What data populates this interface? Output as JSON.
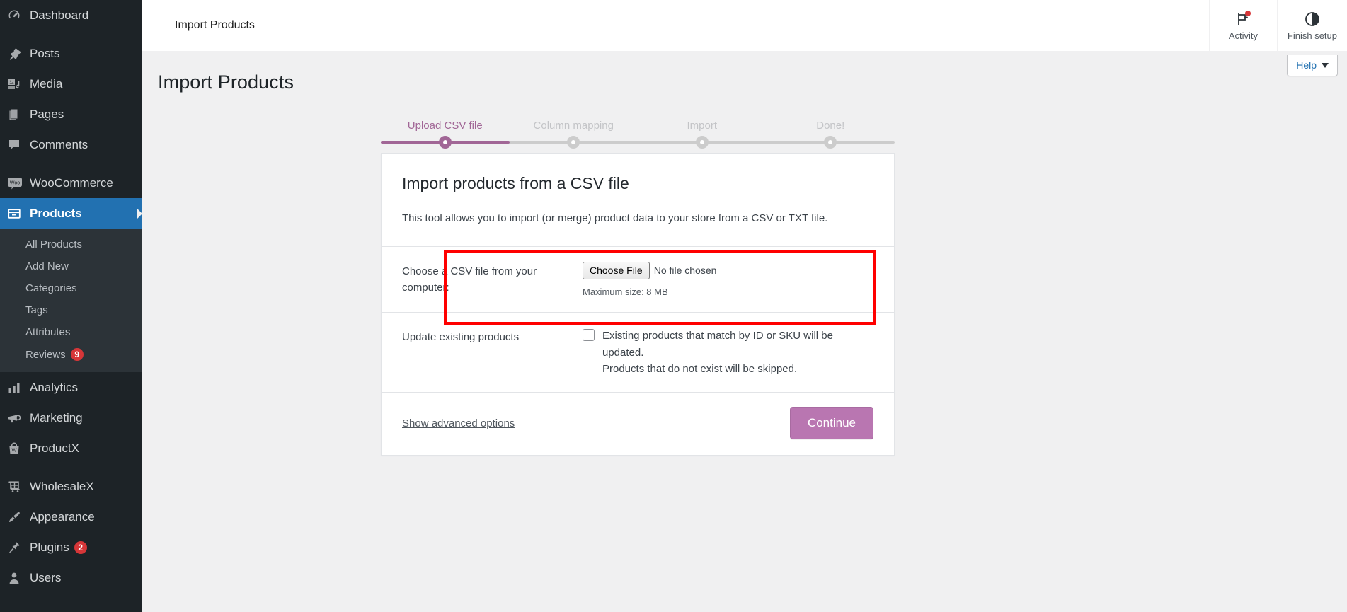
{
  "sidebar": {
    "items": [
      {
        "label": "Dashboard",
        "icon": "dashboard-icon",
        "gap_after": true
      },
      {
        "label": "Posts",
        "icon": "pin-icon"
      },
      {
        "label": "Media",
        "icon": "media-icon"
      },
      {
        "label": "Pages",
        "icon": "pages-icon"
      },
      {
        "label": "Comments",
        "icon": "comments-icon",
        "gap_after": true
      },
      {
        "label": "WooCommerce",
        "icon": "woo-icon"
      },
      {
        "label": "Products",
        "icon": "products-icon",
        "current": true
      },
      {
        "label": "Analytics",
        "icon": "analytics-icon"
      },
      {
        "label": "Marketing",
        "icon": "marketing-icon"
      },
      {
        "label": "ProductX",
        "icon": "productx-icon",
        "gap_after": true
      },
      {
        "label": "WholesaleX",
        "icon": "wholesalex-icon"
      },
      {
        "label": "Appearance",
        "icon": "appearance-icon"
      },
      {
        "label": "Plugins",
        "icon": "plugins-icon",
        "badge": "2"
      },
      {
        "label": "Users",
        "icon": "users-icon"
      }
    ],
    "products_submenu": [
      {
        "label": "All Products"
      },
      {
        "label": "Add New"
      },
      {
        "label": "Categories"
      },
      {
        "label": "Tags"
      },
      {
        "label": "Attributes"
      },
      {
        "label": "Reviews",
        "badge": "9"
      }
    ]
  },
  "header": {
    "title": "Import Products",
    "activity_label": "Activity",
    "finish_setup_label": "Finish setup",
    "activity_icon": "flag-icon",
    "finish_setup_icon": "half-circle-progress-icon"
  },
  "help": {
    "label": "Help",
    "icon": "chevron-down-icon"
  },
  "page": {
    "title": "Import Products"
  },
  "stepper": {
    "steps": [
      {
        "label": "Upload CSV file",
        "active": true
      },
      {
        "label": "Column mapping",
        "active": false
      },
      {
        "label": "Import",
        "active": false
      },
      {
        "label": "Done!",
        "active": false
      }
    ],
    "active_color": "#a16696",
    "inactive_color": "#cccccc",
    "progress_percent": 25
  },
  "card": {
    "heading": "Import products from a CSV file",
    "description": "This tool allows you to import (or merge) product data to your store from a CSV or TXT file.",
    "file_row": {
      "label": "Choose a CSV file from your computer:",
      "button_label": "Choose File",
      "file_status": "No file chosen",
      "hint": "Maximum size: 8 MB"
    },
    "update_row": {
      "label": "Update existing products",
      "checkbox_text": "Existing products that match by ID or SKU will be updated.",
      "checkbox_subtext": "Products that do not exist will be skipped.",
      "checked": false
    },
    "footer": {
      "advanced_link": "Show advanced options",
      "continue_label": "Continue",
      "continue_color": "#b976b1"
    }
  },
  "annotation": {
    "highlight_color": "#ff0000",
    "target": "choose-csv-file-row"
  }
}
